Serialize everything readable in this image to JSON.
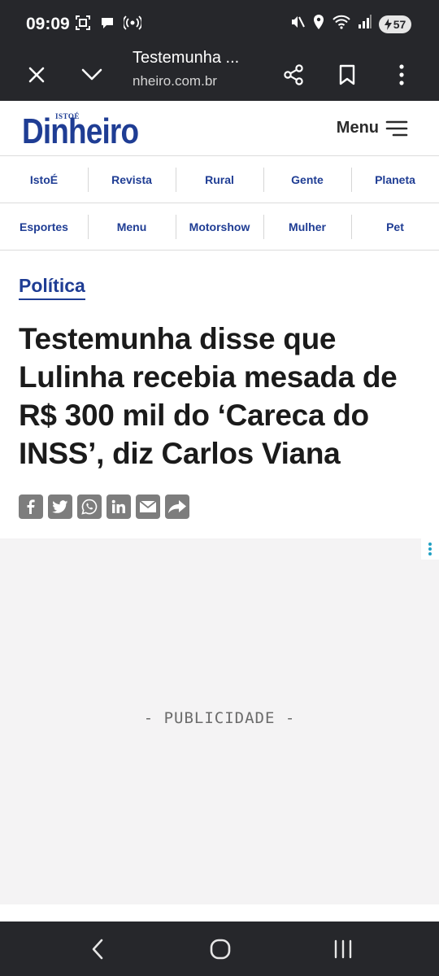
{
  "status_bar": {
    "time": "09:09",
    "battery": "57",
    "icons_left": [
      "screenshot-icon",
      "chat-bubble-icon",
      "hotspot-icon"
    ],
    "icons_right": [
      "mute-icon",
      "location-icon",
      "wifi-icon",
      "signal-icon",
      "battery-icon"
    ]
  },
  "browser": {
    "tab_title": "Testemunha ...",
    "url": "nheiro.com.br"
  },
  "site": {
    "logo_small": "ISTOÉ",
    "logo_main": "Dinheiro",
    "menu_label": "Menu"
  },
  "nav": {
    "row1": [
      {
        "label": "IstoÉ"
      },
      {
        "label": "Revista"
      },
      {
        "label": "Rural"
      },
      {
        "label": "Gente"
      },
      {
        "label": "Planeta"
      }
    ],
    "row2": [
      {
        "label": "Esportes"
      },
      {
        "label": "Menu"
      },
      {
        "label": "Motorshow"
      },
      {
        "label": "Mulher"
      },
      {
        "label": "Pet"
      }
    ]
  },
  "article": {
    "category": "Política",
    "headline": "Testemunha disse que Lulinha recebia mesada de R$ 300 mil do ‘Careca do INSS’, diz Carlos Viana",
    "share_icons": [
      "facebook-icon",
      "twitter-icon",
      "whatsapp-icon",
      "linkedin-icon",
      "email-icon",
      "share-icon"
    ]
  },
  "ad": {
    "label": "- PUBLICIDADE -"
  },
  "colors": {
    "brand": "#1f3d94",
    "chrome": "#26272b",
    "ad_bg": "#f4f3f4"
  }
}
